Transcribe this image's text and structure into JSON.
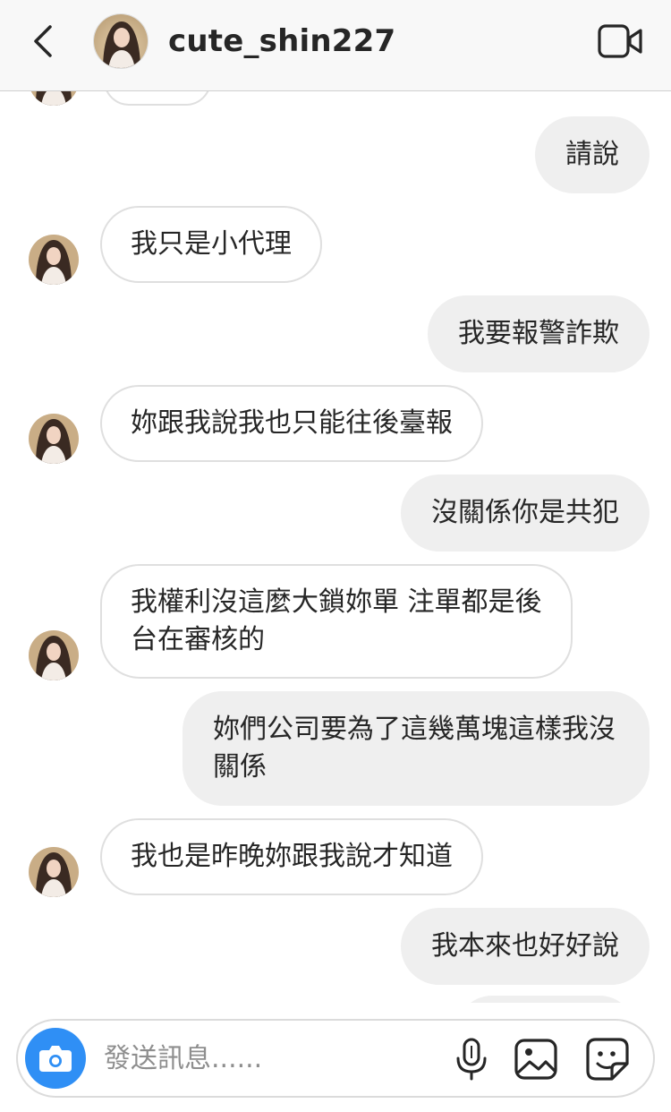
{
  "header": {
    "username": "cute_shin227"
  },
  "messages": [
    {
      "side": "out",
      "text": "請說"
    },
    {
      "side": "in",
      "text": "我只是小代理"
    },
    {
      "side": "out",
      "text": "我要報警詐欺"
    },
    {
      "side": "in",
      "text": "妳跟我說我也只能往後臺報"
    },
    {
      "side": "out",
      "text": "沒關係你是共犯"
    },
    {
      "side": "in",
      "text": "我權利沒這麼大鎖妳單 注單都是後台在審核的"
    },
    {
      "side": "out",
      "text": "妳們公司要為了這幾萬塊這樣我沒關係"
    },
    {
      "side": "in",
      "text": "我也是昨晚妳跟我說才知道"
    },
    {
      "side": "out",
      "text": "我本來也好好說"
    }
  ],
  "composer": {
    "placeholder": "發送訊息......"
  },
  "icons": {
    "back": "chevron-left-icon",
    "video": "video-camera-icon",
    "camera": "camera-icon",
    "mic": "microphone-icon",
    "gallery": "image-icon",
    "sticker": "sticker-icon"
  },
  "colors": {
    "camera_button": "#2f8ff5",
    "outgoing_bubble": "#efefef",
    "incoming_border": "#dfdfdf"
  }
}
